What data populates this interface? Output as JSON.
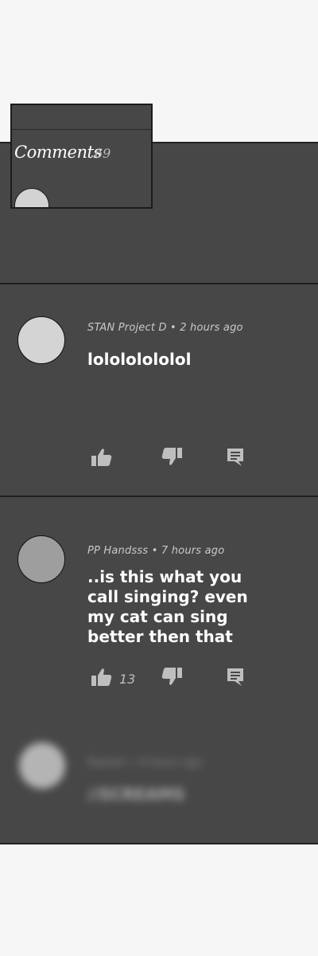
{
  "header": {
    "title": "Comments",
    "count": "69"
  },
  "comments": [
    {
      "author": "STAN Project D",
      "time": "2 hours ago",
      "text": "lolololololol",
      "likes": "",
      "avatar_color": "#d4d4d4"
    },
    {
      "author": "PP Handsss",
      "time": "7 hours ago",
      "text": "..is this what you call singing? even my cat can sing better then that",
      "likes": "13",
      "avatar_color": "#9e9e9e"
    },
    {
      "author": "Replies",
      "time": "9 hours ago",
      "text": "//SCREAMS",
      "likes": "",
      "avatar_color": "#c8c8c8",
      "blurred": true
    }
  ],
  "colors": {
    "panel": "#474747",
    "page": "#f6f6f6",
    "icon": "#bfbfbf",
    "text": "#ffffff"
  },
  "icons": [
    "thumbs-up-icon",
    "thumbs-down-icon",
    "reply-icon"
  ]
}
